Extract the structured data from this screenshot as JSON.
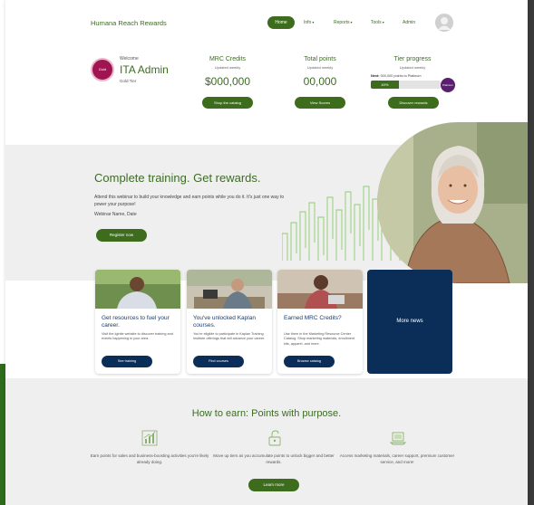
{
  "brand": "Humana Reach Rewards",
  "nav": {
    "home": "Home",
    "info": "Info",
    "reports": "Reports",
    "tools": "Tools",
    "admin": "Admin",
    "caret": "▾"
  },
  "user": {
    "badge": "Gold",
    "welcome": "Welcome",
    "name": "ITA Admin",
    "tier": "Gold Tier"
  },
  "stats": {
    "mrc": {
      "title": "MRC Credits",
      "sub": "Updated weekly",
      "value": "$000,000",
      "button": "Shop the catalog"
    },
    "points": {
      "title": "Total points",
      "sub": "Updated weekly",
      "value": "00,000",
      "button": "View Scores"
    },
    "tier": {
      "title": "Tier progress",
      "sub": "Updated weekly",
      "next_label": "Next:",
      "next_text": "000,000 points to Platinum",
      "progress_label": "40%",
      "progress": 0.4,
      "badge": "Platinum",
      "button": "Discover rewards"
    }
  },
  "hero": {
    "title": "Complete training. Get rewards.",
    "body": "Attend this webinar to build your knowledge and earn points while you do it. It's just one way to power your purpose!",
    "meta": "Webinar Name, Date",
    "button": "Register now"
  },
  "cards": [
    {
      "title": "Get resources to fuel your career.",
      "body": "Visit the Iginite website to discover training and events happening in your area.",
      "button": "See training"
    },
    {
      "title": "You've unlocked Kaplan courses.",
      "body": "You're eligible to participate in Kaplan Training Institute offerings that will advance your career.",
      "button": "Find courses"
    },
    {
      "title": "Earned MRC Credits?",
      "body": "Use them in the Marketing Resource Center Catalog. Shop marketing materials, enrollment kits, apparel, and more.",
      "button": "Browse catalog"
    }
  ],
  "news": "More news",
  "earn": {
    "title": "How to earn: Points with purpose.",
    "items": [
      {
        "icon": "chart-growth-icon",
        "text": "Earn points for sales and business-boosting activities you're likely already doing."
      },
      {
        "icon": "unlock-icon",
        "text": "Move up tiers as you accumulate points to unlock bigger and better rewards."
      },
      {
        "icon": "laptop-icon",
        "text": "Access marketing materials, career support, premium customer service, and more!"
      }
    ],
    "button": "Learn more"
  },
  "colors": {
    "brand_green": "#3d6c1d",
    "navy": "#0b2e59",
    "gold_badge": "#a0154f",
    "platinum_badge": "#5a1f6e",
    "section_gray": "#efefef"
  }
}
